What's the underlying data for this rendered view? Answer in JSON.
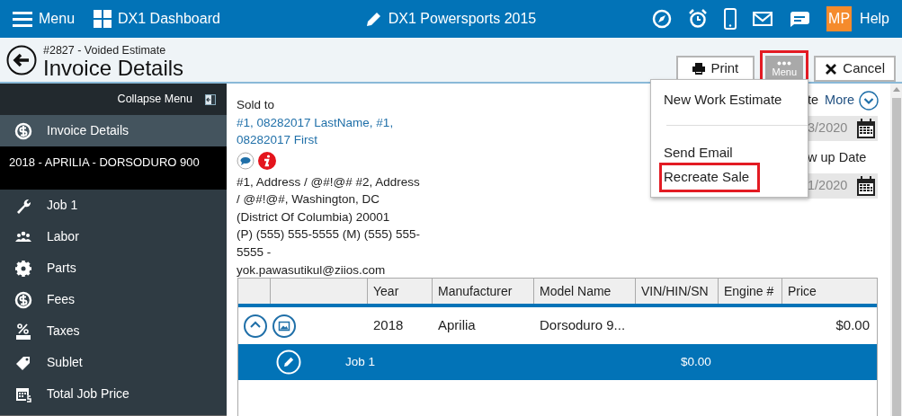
{
  "top_bar": {
    "menu_label": "Menu",
    "dashboard_label": "DX1 Dashboard",
    "store_name": "DX1 Powersports 2015",
    "avatar_initials": "MP",
    "help_label": "Help"
  },
  "header": {
    "subtitle": "#2827 - Voided Estimate",
    "title": "Invoice Details"
  },
  "toolbar": {
    "buttons": [
      {
        "kind": "print",
        "label": "Print",
        "highlighted": false
      },
      {
        "kind": "more",
        "label": "Menu",
        "highlighted": true
      },
      {
        "kind": "cancel",
        "label": "Cancel",
        "highlighted": false
      }
    ]
  },
  "dropdown": {
    "items": [
      {
        "kind": "item",
        "label": "New Work Estimate",
        "highlighted": false
      },
      {
        "kind": "divider"
      },
      {
        "kind": "item",
        "label": "Send Email",
        "highlighted": false
      },
      {
        "kind": "item",
        "label": "Recreate Sale",
        "highlighted": true
      }
    ]
  },
  "sidebar": {
    "collapse_label": "Collapse Menu",
    "top_items": [
      {
        "kind": "dollar",
        "label": "Invoice Details",
        "selected": true
      }
    ],
    "vehicle_label": "2018 - APRILIA - DORSODURO 900",
    "items": [
      {
        "kind": "wrench",
        "label": "Job 1",
        "selected": false
      },
      {
        "kind": "people",
        "label": "Labor",
        "selected": false
      },
      {
        "kind": "gear",
        "label": "Parts",
        "selected": false
      },
      {
        "kind": "dollar",
        "label": "Fees",
        "selected": false
      },
      {
        "kind": "tax",
        "label": "Taxes",
        "selected": false
      },
      {
        "kind": "tag",
        "label": "Sublet",
        "selected": false
      },
      {
        "kind": "calendar",
        "label": "Total Job Price",
        "selected": false
      }
    ]
  },
  "sold_to": {
    "heading": "Sold to",
    "customer_name": "#1, 08282017 LastName, #1, 08282017 First",
    "address": "#1, Address / @#!@# #2, Address / @#!@#, Washington, DC (District Of Columbia) 20001",
    "contact": "(P) (555) 555-5555 (M) (555) 555-5555 - yok.pawasutikul@ziios.com"
  },
  "side_panel": {
    "label_1": "te",
    "more_label": "More",
    "date_1": "3/2020",
    "label_2": "w up Date",
    "date_2": "1/2020"
  },
  "vehicles_table": {
    "columns": [
      "Year",
      "Manufacturer",
      "Model Name",
      "VIN/HIN/SN",
      "Engine #",
      "Price"
    ],
    "rows": [
      {
        "year": "2018",
        "manufacturer": "Aprilia",
        "model_name": "Dorsoduro 9...",
        "price": "$0.00",
        "expanded": true,
        "jobs": [
          {
            "name": "Job 1",
            "price": "$0.00",
            "selected": true
          }
        ]
      }
    ]
  }
}
